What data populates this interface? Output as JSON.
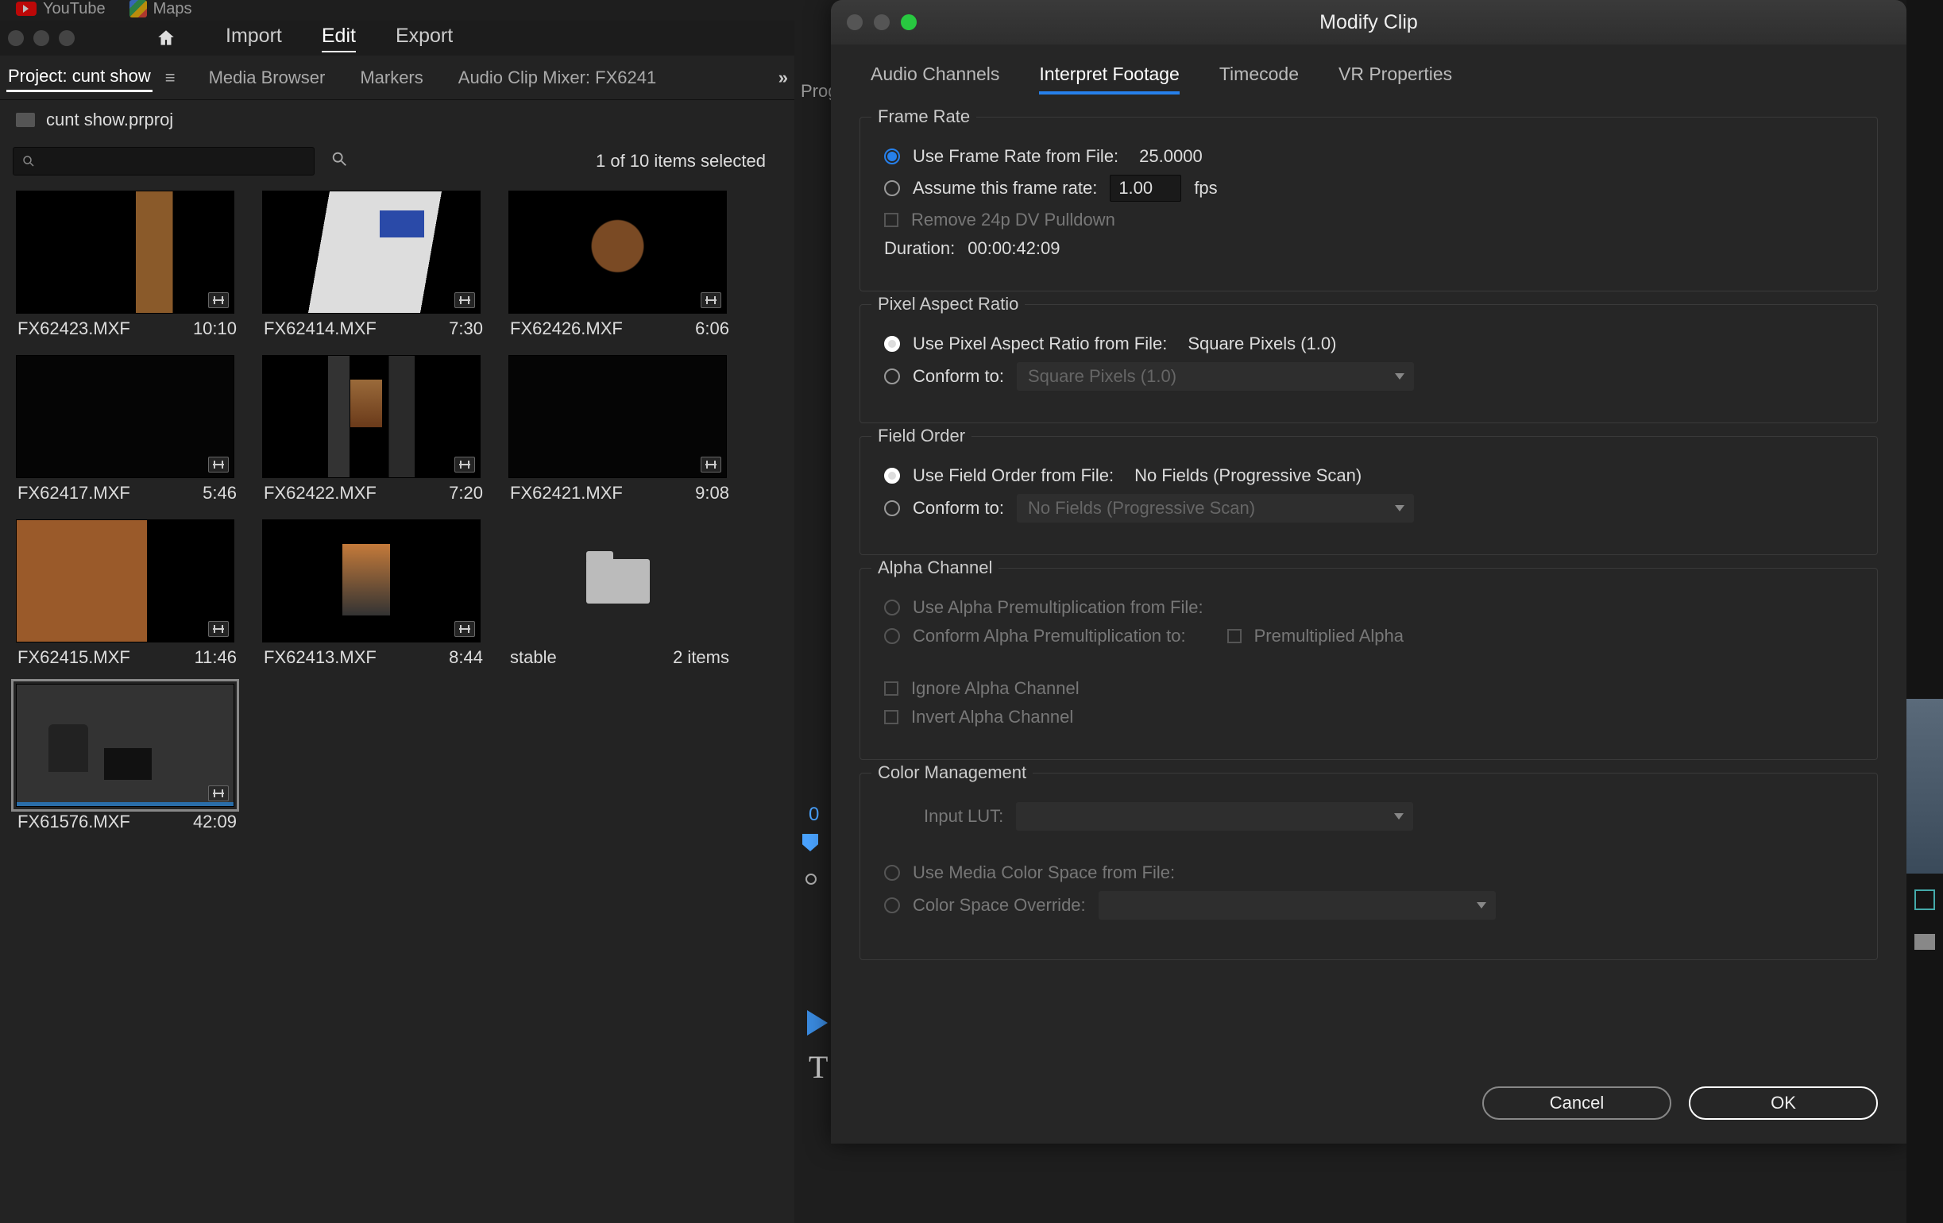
{
  "browser": {
    "youtube": "YouTube",
    "maps": "Maps"
  },
  "topmenu": {
    "import": "Import",
    "edit": "Edit",
    "export": "Export"
  },
  "panels": {
    "project": "Project: cunt show",
    "media_browser": "Media Browser",
    "markers": "Markers",
    "audio_mixer": "Audio Clip Mixer: FX6241",
    "program_hint": "Prog"
  },
  "project_file": "cunt show.prproj",
  "selection_count": "1 of 10 items selected",
  "clips": [
    {
      "name": "FX62423.MXF",
      "dur": "10:10",
      "thumb": "th-person-left"
    },
    {
      "name": "FX62414.MXF",
      "dur": "7:30",
      "thumb": "th-screen"
    },
    {
      "name": "FX62426.MXF",
      "dur": "6:06",
      "thumb": "th-person-center"
    },
    {
      "name": "FX62417.MXF",
      "dur": "5:46",
      "thumb": "th-dark"
    },
    {
      "name": "FX62422.MXF",
      "dur": "7:20",
      "thumb": "th-tripod"
    },
    {
      "name": "FX62421.MXF",
      "dur": "9:08",
      "thumb": "th-dark"
    },
    {
      "name": "FX62415.MXF",
      "dur": "11:46",
      "thumb": "th-orange"
    },
    {
      "name": "FX62413.MXF",
      "dur": "8:44",
      "thumb": "th-walk"
    }
  ],
  "folder": {
    "name": "stable",
    "items": "2 items"
  },
  "selected_clip": {
    "name": "FX61576.MXF",
    "dur": "42:09",
    "thumb": "th-office"
  },
  "tc_hint": "0",
  "t_glyph": "T",
  "modal": {
    "title": "Modify Clip",
    "tabs": {
      "audio": "Audio Channels",
      "interpret": "Interpret Footage",
      "timecode": "Timecode",
      "vr": "VR Properties"
    },
    "frame_rate": {
      "legend": "Frame Rate",
      "use_file": "Use Frame Rate from File:",
      "file_value": "25.0000",
      "assume": "Assume this frame rate:",
      "assume_value": "1.00",
      "fps": "fps",
      "remove_pulldown": "Remove 24p DV Pulldown",
      "duration_label": "Duration:",
      "duration_value": "00:00:42:09"
    },
    "par": {
      "legend": "Pixel Aspect Ratio",
      "use_file": "Use Pixel Aspect Ratio from File:",
      "file_value": "Square Pixels (1.0)",
      "conform": "Conform to:",
      "conform_value": "Square Pixels (1.0)"
    },
    "field": {
      "legend": "Field Order",
      "use_file": "Use Field Order from File:",
      "file_value": "No Fields (Progressive Scan)",
      "conform": "Conform to:",
      "conform_value": "No Fields (Progressive Scan)"
    },
    "alpha": {
      "legend": "Alpha Channel",
      "use_file": "Use Alpha Premultiplication from File:",
      "conform": "Conform Alpha Premultiplication to:",
      "premult": "Premultiplied Alpha",
      "ignore": "Ignore Alpha Channel",
      "invert": "Invert Alpha Channel"
    },
    "color": {
      "legend": "Color Management",
      "input_lut": "Input LUT:",
      "use_file": "Use Media Color Space from File:",
      "override": "Color Space Override:"
    },
    "buttons": {
      "cancel": "Cancel",
      "ok": "OK"
    }
  }
}
